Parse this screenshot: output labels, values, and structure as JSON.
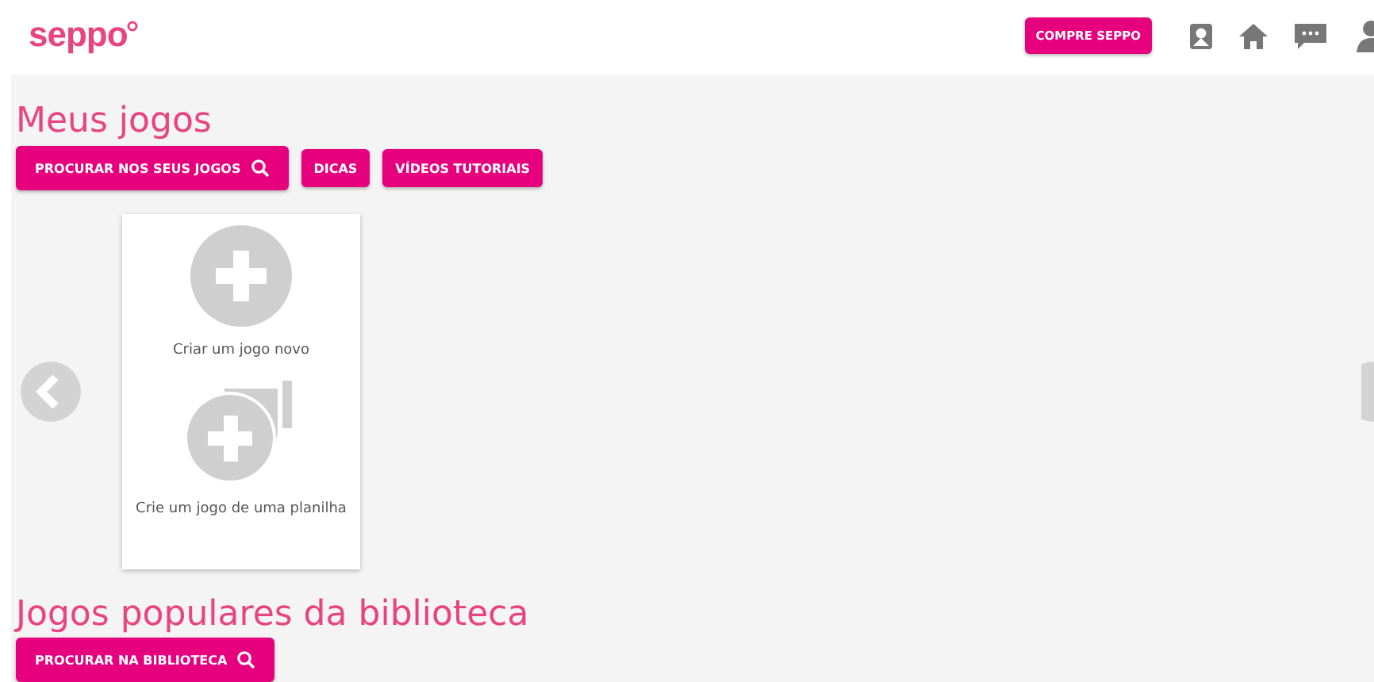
{
  "header": {
    "logo": "seppo",
    "buy_button": "COMPRE SEPPO"
  },
  "my_games": {
    "title": "Meus jogos",
    "buttons": [
      {
        "label": "PROCURAR NOS SEUS JOGOS",
        "search": true
      },
      {
        "label": "DICAS",
        "search": false
      },
      {
        "label": "VÍDEOS TUTORIAIS",
        "search": false
      }
    ],
    "cards": [
      {
        "kind": "new",
        "label": "Criar um jogo novo"
      },
      {
        "kind": "sheet",
        "label": "Crie um jogo de uma planilha"
      }
    ]
  },
  "library": {
    "title": "Jogos populares da biblioteca",
    "button": {
      "label": "PROCURAR NA BIBLIOTECA",
      "search": true
    }
  }
}
